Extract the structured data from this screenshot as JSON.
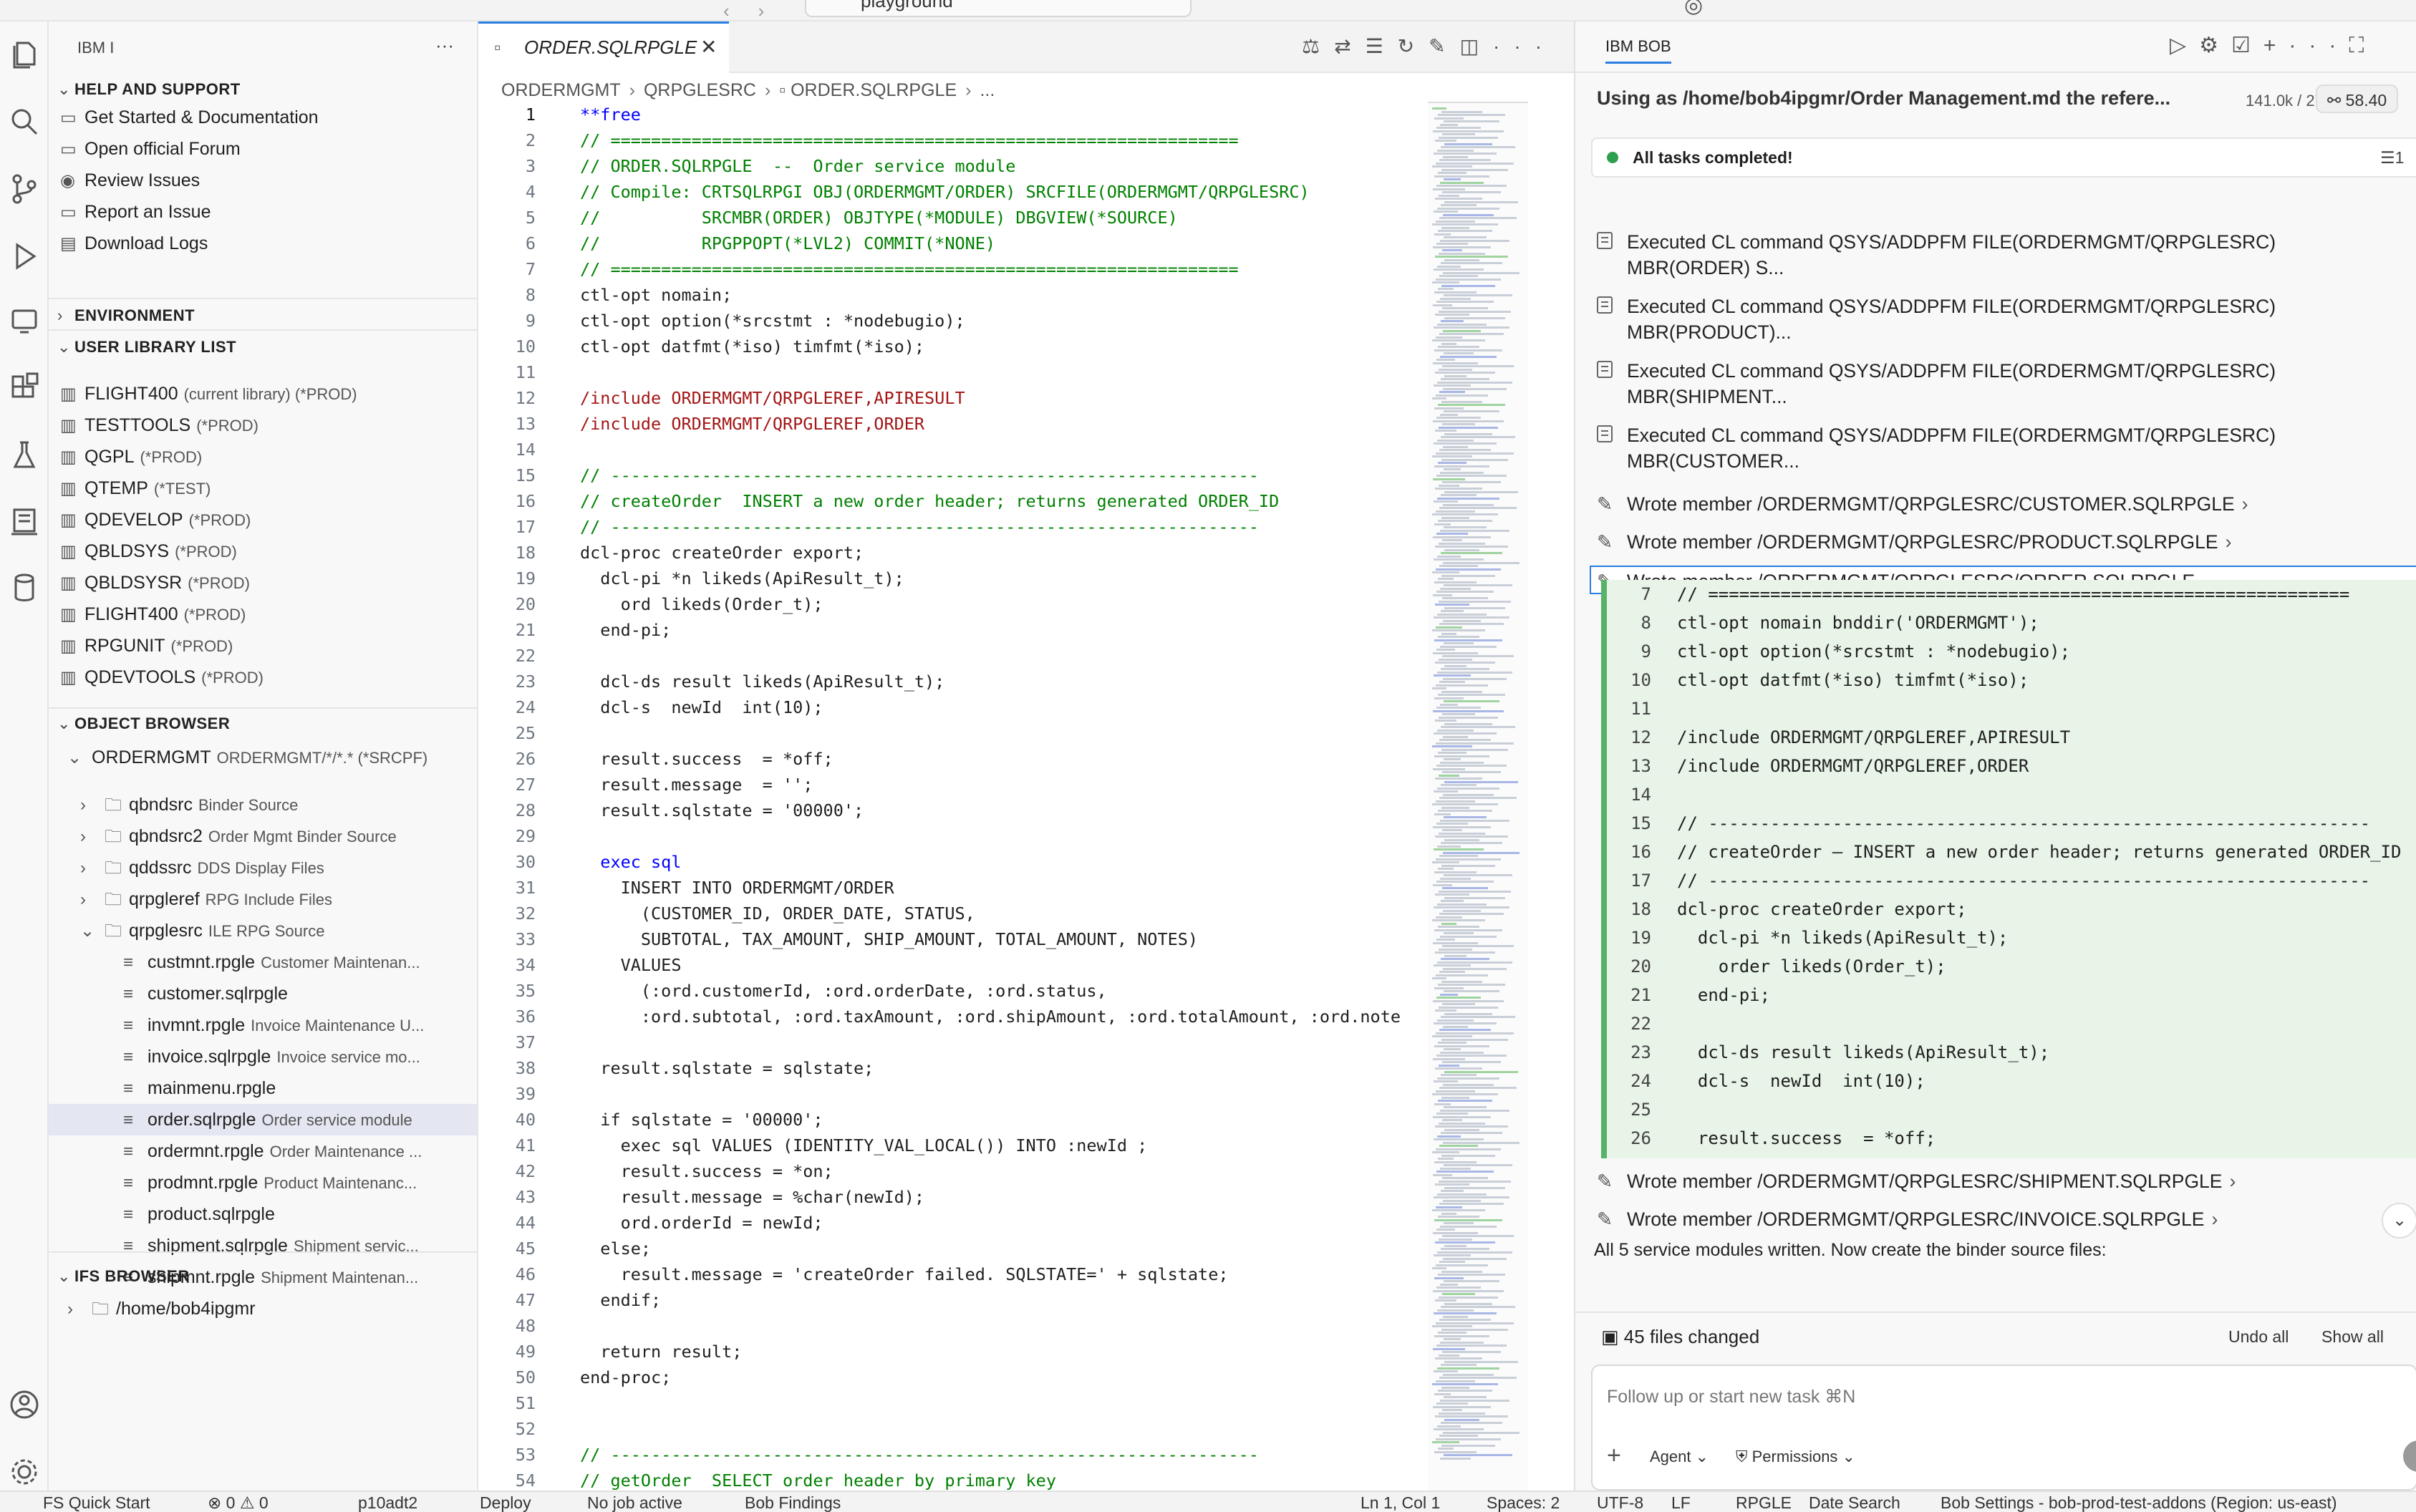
{
  "topbar": {
    "command_center_text": "playground"
  },
  "sidebar": {
    "title": "IBM I",
    "help": {
      "header": "HELP AND SUPPORT",
      "items": [
        "Get Started & Documentation",
        "Open official Forum",
        "Review Issues",
        "Report an Issue",
        "Download Logs"
      ]
    },
    "environment_header": "ENVIRONMENT",
    "library_list": {
      "header": "USER LIBRARY LIST",
      "items": [
        {
          "name": "FLIGHT400",
          "desc": "(current library) (*PROD)"
        },
        {
          "name": "TESTTOOLS",
          "desc": "(*PROD)"
        },
        {
          "name": "QGPL",
          "desc": "(*PROD)"
        },
        {
          "name": "QTEMP",
          "desc": "(*TEST)"
        },
        {
          "name": "QDEVELOP",
          "desc": "(*PROD)"
        },
        {
          "name": "QBLDSYS",
          "desc": "(*PROD)"
        },
        {
          "name": "QBLDSYSR",
          "desc": "(*PROD)"
        },
        {
          "name": "FLIGHT400",
          "desc": "(*PROD)"
        },
        {
          "name": "RPGUNIT",
          "desc": "(*PROD)"
        },
        {
          "name": "QDEVTOOLS",
          "desc": "(*PROD)"
        }
      ]
    },
    "object_browser": {
      "header": "OBJECT BROWSER",
      "root": {
        "name": "ORDERMGMT",
        "desc": "ORDERMGMT/*/*.* (*SRCPF)"
      },
      "folders": [
        {
          "name": "qbndsrc",
          "desc": "Binder Source"
        },
        {
          "name": "qbndsrc2",
          "desc": "Order Mgmt Binder Source"
        },
        {
          "name": "qddssrc",
          "desc": "DDS Display Files"
        },
        {
          "name": "qrpgleref",
          "desc": "RPG Include Files"
        },
        {
          "name": "qrpglesrc",
          "desc": "ILE RPG Source"
        }
      ],
      "members": [
        {
          "name": "custmnt.rpgle",
          "desc": "Customer Maintenan..."
        },
        {
          "name": "customer.sqlrpgle",
          "desc": ""
        },
        {
          "name": "invmnt.rpgle",
          "desc": "Invoice Maintenance U..."
        },
        {
          "name": "invoice.sqlrpgle",
          "desc": "Invoice service mo..."
        },
        {
          "name": "mainmenu.rpgle",
          "desc": ""
        },
        {
          "name": "order.sqlrpgle",
          "desc": "Order service module"
        },
        {
          "name": "ordermnt.rpgle",
          "desc": "Order Maintenance ..."
        },
        {
          "name": "prodmnt.rpgle",
          "desc": "Product Maintenanc..."
        },
        {
          "name": "product.sqlrpgle",
          "desc": ""
        },
        {
          "name": "shipment.sqlrpgle",
          "desc": "Shipment servic..."
        },
        {
          "name": "shipmnt.rpgle",
          "desc": "Shipment Maintenan..."
        }
      ]
    },
    "ifs": {
      "header": "IFS BROWSER",
      "item": "/home/bob4ipgmr"
    }
  },
  "editor": {
    "tab_label": "ORDER.SQLRPGLE",
    "breadcrumbs": [
      "ORDERMGMT",
      "QRPGLESRC",
      "ORDER.SQLRPGLE",
      "..."
    ],
    "lines": [
      {
        "n": "1",
        "t": "**free",
        "c": "kw"
      },
      {
        "n": "2",
        "t": "// ==============================================================",
        "c": "cm"
      },
      {
        "n": "3",
        "t": "// ORDER.SQLRPGLE  --  Order service module",
        "c": "cm"
      },
      {
        "n": "4",
        "t": "// Compile: CRTSQLRPGI OBJ(ORDERMGMT/ORDER) SRCFILE(ORDERMGMT/QRPGLESRC)",
        "c": "cm"
      },
      {
        "n": "5",
        "t": "//          SRCMBR(ORDER) OBJTYPE(*MODULE) DBGVIEW(*SOURCE)",
        "c": "cm"
      },
      {
        "n": "6",
        "t": "//          RPGPPOPT(*LVL2) COMMIT(*NONE)",
        "c": "cm"
      },
      {
        "n": "7",
        "t": "// ==============================================================",
        "c": "cm"
      },
      {
        "n": "8",
        "t": "ctl-opt nomain;",
        "c": "tx"
      },
      {
        "n": "9",
        "t": "ctl-opt option(*srcstmt : *nodebugio);",
        "c": "tx"
      },
      {
        "n": "10",
        "t": "ctl-opt datfmt(*iso) timfmt(*iso);",
        "c": "tx"
      },
      {
        "n": "11",
        "t": "",
        "c": "tx"
      },
      {
        "n": "12",
        "t": "/include ORDERMGMT/QRPGLEREF,APIRESULT",
        "c": "str"
      },
      {
        "n": "13",
        "t": "/include ORDERMGMT/QRPGLEREF,ORDER",
        "c": "str"
      },
      {
        "n": "14",
        "t": "",
        "c": "tx"
      },
      {
        "n": "15",
        "t": "// ----------------------------------------------------------------",
        "c": "cm"
      },
      {
        "n": "16",
        "t": "// createOrder  INSERT a new order header; returns generated ORDER_ID",
        "c": "cm"
      },
      {
        "n": "17",
        "t": "// ----------------------------------------------------------------",
        "c": "cm"
      },
      {
        "n": "18",
        "t": "dcl-proc createOrder export;",
        "c": "tx"
      },
      {
        "n": "19",
        "t": "  dcl-pi *n likeds(ApiResult_t);",
        "c": "tx"
      },
      {
        "n": "20",
        "t": "    ord likeds(Order_t);",
        "c": "tx"
      },
      {
        "n": "21",
        "t": "  end-pi;",
        "c": "tx"
      },
      {
        "n": "22",
        "t": "",
        "c": "tx"
      },
      {
        "n": "23",
        "t": "  dcl-ds result likeds(ApiResult_t);",
        "c": "tx"
      },
      {
        "n": "24",
        "t": "  dcl-s  newId  int(10);",
        "c": "tx"
      },
      {
        "n": "25",
        "t": "",
        "c": "tx"
      },
      {
        "n": "26",
        "t": "  result.success  = *off;",
        "c": "tx"
      },
      {
        "n": "27",
        "t": "  result.message  = '';",
        "c": "tx"
      },
      {
        "n": "28",
        "t": "  result.sqlstate = '00000';",
        "c": "tx"
      },
      {
        "n": "29",
        "t": "",
        "c": "tx"
      },
      {
        "n": "30",
        "t": "  exec sql",
        "c": "kw"
      },
      {
        "n": "31",
        "t": "    INSERT INTO ORDERMGMT/ORDER",
        "c": "tx"
      },
      {
        "n": "32",
        "t": "      (CUSTOMER_ID, ORDER_DATE, STATUS,",
        "c": "tx"
      },
      {
        "n": "33",
        "t": "      SUBTOTAL, TAX_AMOUNT, SHIP_AMOUNT, TOTAL_AMOUNT, NOTES)",
        "c": "tx"
      },
      {
        "n": "34",
        "t": "    VALUES",
        "c": "tx"
      },
      {
        "n": "35",
        "t": "      (:ord.customerId, :ord.orderDate, :ord.status,",
        "c": "tx"
      },
      {
        "n": "36",
        "t": "      :ord.subtotal, :ord.taxAmount, :ord.shipAmount, :ord.totalAmount, :ord.note",
        "c": "tx"
      },
      {
        "n": "37",
        "t": "",
        "c": "tx"
      },
      {
        "n": "38",
        "t": "  result.sqlstate = sqlstate;",
        "c": "tx"
      },
      {
        "n": "39",
        "t": "",
        "c": "tx"
      },
      {
        "n": "40",
        "t": "  if sqlstate = '00000';",
        "c": "tx"
      },
      {
        "n": "41",
        "t": "    exec sql VALUES (IDENTITY_VAL_LOCAL()) INTO :newId ;",
        "c": "tx"
      },
      {
        "n": "42",
        "t": "    result.success = *on;",
        "c": "tx"
      },
      {
        "n": "43",
        "t": "    result.message = %char(newId);",
        "c": "tx"
      },
      {
        "n": "44",
        "t": "    ord.orderId = newId;",
        "c": "tx"
      },
      {
        "n": "45",
        "t": "  else;",
        "c": "tx"
      },
      {
        "n": "46",
        "t": "    result.message = 'createOrder failed. SQLSTATE=' + sqlstate;",
        "c": "tx"
      },
      {
        "n": "47",
        "t": "  endif;",
        "c": "tx"
      },
      {
        "n": "48",
        "t": "",
        "c": "tx"
      },
      {
        "n": "49",
        "t": "  return result;",
        "c": "tx"
      },
      {
        "n": "50",
        "t": "end-proc;",
        "c": "tx"
      },
      {
        "n": "51",
        "t": "",
        "c": "tx"
      },
      {
        "n": "52",
        "t": "",
        "c": "tx"
      },
      {
        "n": "53",
        "t": "// ----------------------------------------------------------------",
        "c": "cm"
      },
      {
        "n": "54",
        "t": "// getOrder  SELECT order header by primary key",
        "c": "cm"
      }
    ]
  },
  "bob": {
    "panel_title": "IBM BOB",
    "task_title": "Using as /home/bob4ipgmr/Order Management.md the refere...",
    "tokens": "141.0k / 270.0k",
    "cost": "58.40",
    "status": "All tasks completed!",
    "executed": [
      "Executed CL command QSYS/ADDPFM FILE(ORDERMGMT/QRPGLESRC) MBR(ORDER) S...",
      "Executed CL command QSYS/ADDPFM FILE(ORDERMGMT/QRPGLESRC) MBR(PRODUCT)...",
      "Executed CL command QSYS/ADDPFM FILE(ORDERMGMT/QRPGLESRC) MBR(SHIPMENT...",
      "Executed CL command QSYS/ADDPFM FILE(ORDERMGMT/QRPGLESRC) MBR(CUSTOMER..."
    ],
    "wrote_before": [
      "Wrote member /ORDERMGMT/QRPGLESRC/CUSTOMER.SQLRPGLE",
      "Wrote member /ORDERMGMT/QRPGLESRC/PRODUCT.SQLRPGLE",
      "Wrote member /ORDERMGMT/QRPGLESRC/ORDER.SQLRPGLE"
    ],
    "diff_lines": [
      {
        "n": "7",
        "t": "// =============================================================="
      },
      {
        "n": "8",
        "t": "ctl-opt nomain bnddir('ORDERMGMT');"
      },
      {
        "n": "9",
        "t": "ctl-opt option(*srcstmt : *nodebugio);"
      },
      {
        "n": "10",
        "t": "ctl-opt datfmt(*iso) timfmt(*iso);"
      },
      {
        "n": "11",
        "t": ""
      },
      {
        "n": "12",
        "t": "/include ORDERMGMT/QRPGLEREF,APIRESULT"
      },
      {
        "n": "13",
        "t": "/include ORDERMGMT/QRPGLEREF,ORDER"
      },
      {
        "n": "14",
        "t": ""
      },
      {
        "n": "15",
        "t": "// ----------------------------------------------------------------"
      },
      {
        "n": "16",
        "t": "// createOrder — INSERT a new order header; returns generated ORDER_ID"
      },
      {
        "n": "17",
        "t": "// ----------------------------------------------------------------"
      },
      {
        "n": "18",
        "t": "dcl-proc createOrder export;"
      },
      {
        "n": "19",
        "t": "  dcl-pi *n likeds(ApiResult_t);"
      },
      {
        "n": "20",
        "t": "    order likeds(Order_t);"
      },
      {
        "n": "21",
        "t": "  end-pi;"
      },
      {
        "n": "22",
        "t": ""
      },
      {
        "n": "23",
        "t": "  dcl-ds result likeds(ApiResult_t);"
      },
      {
        "n": "24",
        "t": "  dcl-s  newId  int(10);"
      },
      {
        "n": "25",
        "t": ""
      },
      {
        "n": "26",
        "t": "  result.success  = *off;"
      }
    ],
    "wrote_after": [
      "Wrote member /ORDERMGMT/QRPGLESRC/SHIPMENT.SQLRPGLE",
      "Wrote member /ORDERMGMT/QRPGLESRC/INVOICE.SQLRPGLE"
    ],
    "summary": "All 5 service modules written. Now create the binder source files:",
    "files_changed": "45 files changed",
    "undo_all": "Undo all",
    "show_all": "Show all",
    "input_placeholder": "Follow up or start new task ⌘N",
    "agent_label": "Agent",
    "permissions_label": "Permissions"
  },
  "statusbar": {
    "items": [
      "FS Quick Start",
      "⊗ 0 ⚠ 0",
      "p10adt2",
      "Deploy",
      "No job active",
      "Bob Findings",
      "Ln 1, Col 1",
      "Spaces: 2",
      "UTF-8",
      "LF",
      "RPGLE",
      "Date Search",
      "Bob Settings - bob-prod-test-addons (Region: us-east)"
    ]
  },
  "colors": {
    "accent": "#2a7de1",
    "comment": "#008000",
    "keyword": "#0000ff",
    "string": "#a31515",
    "diff_bg": "#e8f4e8",
    "diff_bar": "#58b368",
    "status_ok": "#2e9e4f"
  }
}
